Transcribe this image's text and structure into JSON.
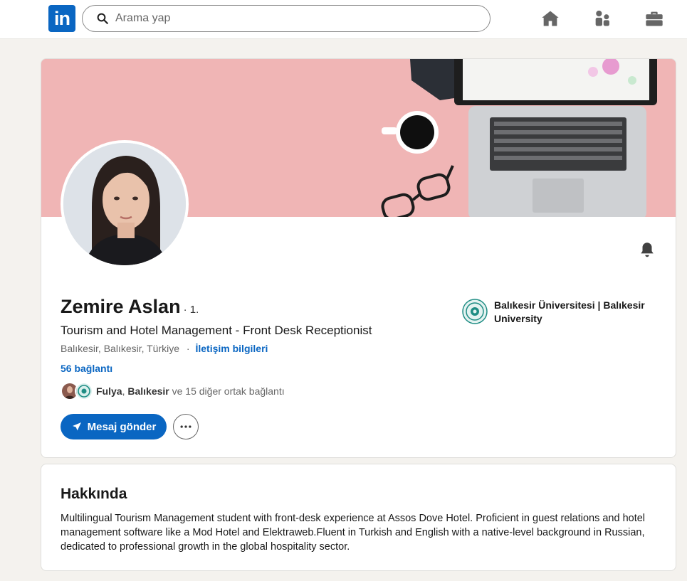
{
  "header": {
    "logo_text": "in",
    "search_placeholder": "Arama yap",
    "nav": [
      {
        "icon": "home-icon"
      },
      {
        "icon": "my-network-icon"
      },
      {
        "icon": "jobs-icon"
      }
    ]
  },
  "profile": {
    "name": "Zemire Aslan",
    "degree": "· 1.",
    "headline": "Tourism and Hotel Management - Front Desk Receptionist",
    "location": "Balıkesir, Balıkesir, Türkiye",
    "contact_separator": "·",
    "contact_link": "İletişim bilgileri",
    "connections": "56 bağlantı",
    "mutual": {
      "name1": "Fulya",
      "sep": ",",
      "name2": "Balıkesir",
      "rest": "ve 15 diğer ortak bağlantı"
    },
    "message_button": "Mesaj gönder",
    "education": "Balıkesir Üniversitesi | Balıkesir University"
  },
  "about": {
    "title": "Hakkında",
    "text": "Multilingual Tourism Management student with front-desk experience at Assos Dove Hotel. Proficient in guest relations and hotel management software like a Mod Hotel and Elektraweb.Fluent in Turkish and English with a native-level background in Russian, dedicated to professional growth in the global hospitality sector."
  },
  "colors": {
    "brand": "#0a66c2",
    "banner": "#f0b5b5",
    "page_bg": "#f4f2ee"
  }
}
